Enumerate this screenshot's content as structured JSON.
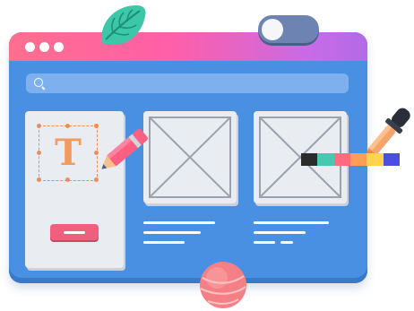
{
  "scene": {
    "window": {
      "title_dots": [
        "dot",
        "dot",
        "dot"
      ],
      "search": {
        "icon": "search-icon",
        "placeholder": ""
      }
    },
    "editor_panel": {
      "tool_icon": "text-tool-icon",
      "text_glyph": "T",
      "action_button": "primary-button"
    },
    "wireframes": [
      {
        "name": "image-placeholder-1",
        "text_lines": 3
      },
      {
        "name": "image-placeholder-2",
        "text_lines": 3
      }
    ],
    "decorations": {
      "leaf": "leaf-icon",
      "toggle": {
        "icon": "toggle-switch-icon",
        "state": "on"
      },
      "pencil": "pencil-icon",
      "pipette": "color-dropper-icon",
      "palette_swatches": [
        "#2b2b2b",
        "#46c9b0",
        "#ff6b7f",
        "#ff9f55",
        "#ffd24f",
        "#4a4fe0"
      ],
      "ball": "ball-icon"
    },
    "colors": {
      "window_blue": "#4a90e2",
      "titlebar_start": "#ff6f8e",
      "titlebar_end": "#b36ae6",
      "accent_orange": "#f39a5e",
      "button_pink": "#f0607e"
    }
  }
}
